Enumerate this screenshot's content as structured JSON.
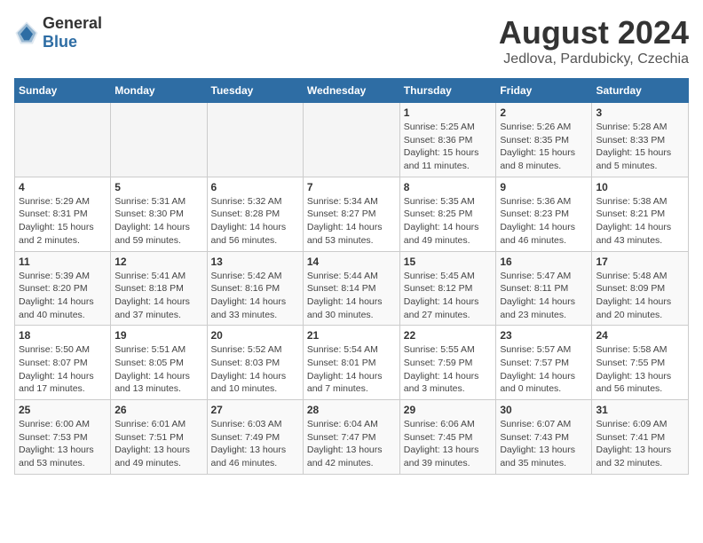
{
  "header": {
    "logo_general": "General",
    "logo_blue": "Blue",
    "month_title": "August 2024",
    "location": "Jedlova, Pardubicky, Czechia"
  },
  "calendar": {
    "days_of_week": [
      "Sunday",
      "Monday",
      "Tuesday",
      "Wednesday",
      "Thursday",
      "Friday",
      "Saturday"
    ],
    "weeks": [
      [
        {
          "day": "",
          "info": ""
        },
        {
          "day": "",
          "info": ""
        },
        {
          "day": "",
          "info": ""
        },
        {
          "day": "",
          "info": ""
        },
        {
          "day": "1",
          "info": "Sunrise: 5:25 AM\nSunset: 8:36 PM\nDaylight: 15 hours\nand 11 minutes."
        },
        {
          "day": "2",
          "info": "Sunrise: 5:26 AM\nSunset: 8:35 PM\nDaylight: 15 hours\nand 8 minutes."
        },
        {
          "day": "3",
          "info": "Sunrise: 5:28 AM\nSunset: 8:33 PM\nDaylight: 15 hours\nand 5 minutes."
        }
      ],
      [
        {
          "day": "4",
          "info": "Sunrise: 5:29 AM\nSunset: 8:31 PM\nDaylight: 15 hours\nand 2 minutes."
        },
        {
          "day": "5",
          "info": "Sunrise: 5:31 AM\nSunset: 8:30 PM\nDaylight: 14 hours\nand 59 minutes."
        },
        {
          "day": "6",
          "info": "Sunrise: 5:32 AM\nSunset: 8:28 PM\nDaylight: 14 hours\nand 56 minutes."
        },
        {
          "day": "7",
          "info": "Sunrise: 5:34 AM\nSunset: 8:27 PM\nDaylight: 14 hours\nand 53 minutes."
        },
        {
          "day": "8",
          "info": "Sunrise: 5:35 AM\nSunset: 8:25 PM\nDaylight: 14 hours\nand 49 minutes."
        },
        {
          "day": "9",
          "info": "Sunrise: 5:36 AM\nSunset: 8:23 PM\nDaylight: 14 hours\nand 46 minutes."
        },
        {
          "day": "10",
          "info": "Sunrise: 5:38 AM\nSunset: 8:21 PM\nDaylight: 14 hours\nand 43 minutes."
        }
      ],
      [
        {
          "day": "11",
          "info": "Sunrise: 5:39 AM\nSunset: 8:20 PM\nDaylight: 14 hours\nand 40 minutes."
        },
        {
          "day": "12",
          "info": "Sunrise: 5:41 AM\nSunset: 8:18 PM\nDaylight: 14 hours\nand 37 minutes."
        },
        {
          "day": "13",
          "info": "Sunrise: 5:42 AM\nSunset: 8:16 PM\nDaylight: 14 hours\nand 33 minutes."
        },
        {
          "day": "14",
          "info": "Sunrise: 5:44 AM\nSunset: 8:14 PM\nDaylight: 14 hours\nand 30 minutes."
        },
        {
          "day": "15",
          "info": "Sunrise: 5:45 AM\nSunset: 8:12 PM\nDaylight: 14 hours\nand 27 minutes."
        },
        {
          "day": "16",
          "info": "Sunrise: 5:47 AM\nSunset: 8:11 PM\nDaylight: 14 hours\nand 23 minutes."
        },
        {
          "day": "17",
          "info": "Sunrise: 5:48 AM\nSunset: 8:09 PM\nDaylight: 14 hours\nand 20 minutes."
        }
      ],
      [
        {
          "day": "18",
          "info": "Sunrise: 5:50 AM\nSunset: 8:07 PM\nDaylight: 14 hours\nand 17 minutes."
        },
        {
          "day": "19",
          "info": "Sunrise: 5:51 AM\nSunset: 8:05 PM\nDaylight: 14 hours\nand 13 minutes."
        },
        {
          "day": "20",
          "info": "Sunrise: 5:52 AM\nSunset: 8:03 PM\nDaylight: 14 hours\nand 10 minutes."
        },
        {
          "day": "21",
          "info": "Sunrise: 5:54 AM\nSunset: 8:01 PM\nDaylight: 14 hours\nand 7 minutes."
        },
        {
          "day": "22",
          "info": "Sunrise: 5:55 AM\nSunset: 7:59 PM\nDaylight: 14 hours\nand 3 minutes."
        },
        {
          "day": "23",
          "info": "Sunrise: 5:57 AM\nSunset: 7:57 PM\nDaylight: 14 hours\nand 0 minutes."
        },
        {
          "day": "24",
          "info": "Sunrise: 5:58 AM\nSunset: 7:55 PM\nDaylight: 13 hours\nand 56 minutes."
        }
      ],
      [
        {
          "day": "25",
          "info": "Sunrise: 6:00 AM\nSunset: 7:53 PM\nDaylight: 13 hours\nand 53 minutes."
        },
        {
          "day": "26",
          "info": "Sunrise: 6:01 AM\nSunset: 7:51 PM\nDaylight: 13 hours\nand 49 minutes."
        },
        {
          "day": "27",
          "info": "Sunrise: 6:03 AM\nSunset: 7:49 PM\nDaylight: 13 hours\nand 46 minutes."
        },
        {
          "day": "28",
          "info": "Sunrise: 6:04 AM\nSunset: 7:47 PM\nDaylight: 13 hours\nand 42 minutes."
        },
        {
          "day": "29",
          "info": "Sunrise: 6:06 AM\nSunset: 7:45 PM\nDaylight: 13 hours\nand 39 minutes."
        },
        {
          "day": "30",
          "info": "Sunrise: 6:07 AM\nSunset: 7:43 PM\nDaylight: 13 hours\nand 35 minutes."
        },
        {
          "day": "31",
          "info": "Sunrise: 6:09 AM\nSunset: 7:41 PM\nDaylight: 13 hours\nand 32 minutes."
        }
      ]
    ]
  }
}
